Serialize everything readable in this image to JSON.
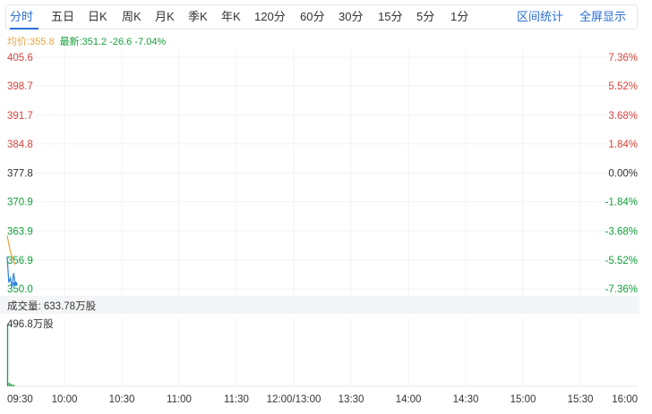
{
  "tabs": [
    {
      "label": "分时",
      "active": true
    },
    {
      "label": "五日"
    },
    {
      "label": "日K"
    },
    {
      "label": "周K"
    },
    {
      "label": "月K"
    },
    {
      "label": "季K"
    },
    {
      "label": "年K"
    },
    {
      "label": "120分"
    },
    {
      "label": "60分"
    },
    {
      "label": "30分"
    },
    {
      "label": "15分"
    },
    {
      "label": "5分"
    },
    {
      "label": "1分"
    }
  ],
  "links": {
    "range_stats": "区间统计",
    "fullscreen": "全屏显示"
  },
  "info": {
    "avg": "均价:355.8",
    "last": "最新:351.2 -26.6 -7.04%"
  },
  "volume": {
    "label": "成交量: 633.78万股"
  },
  "colors": {
    "up": "#d9453d",
    "down": "#14a03c",
    "flat": "#333333",
    "price_line": "#2b7fd9",
    "avg_line": "#e8a43c",
    "volume_bar": "#14a03c",
    "accent": "#2b6fd6"
  },
  "chart_data": [
    {
      "type": "line",
      "name": "price",
      "prev_close": 377.8,
      "ylim": [
        350.0,
        405.6
      ],
      "y_ticks": [
        {
          "price": "405.6",
          "pct": "7.36%",
          "dir": "up"
        },
        {
          "price": "398.7",
          "pct": "5.52%",
          "dir": "up"
        },
        {
          "price": "391.7",
          "pct": "3.68%",
          "dir": "up"
        },
        {
          "price": "384.8",
          "pct": "1.84%",
          "dir": "up"
        },
        {
          "price": "377.8",
          "pct": "0.00%",
          "dir": "flat"
        },
        {
          "price": "370.9",
          "pct": "-1.84%",
          "dir": "down"
        },
        {
          "price": "363.9",
          "pct": "-3.68%",
          "dir": "down"
        },
        {
          "price": "356.9",
          "pct": "-5.52%",
          "dir": "down"
        },
        {
          "price": "350.0",
          "pct": "-7.36%",
          "dir": "down"
        }
      ],
      "x_ticks": [
        "09:30",
        "10:00",
        "10:30",
        "11:00",
        "11:30",
        "12:00/13:00",
        "13:30",
        "14:00",
        "14:30",
        "15:00",
        "15:30",
        "16:00"
      ],
      "price_series": [
        {
          "t": 0,
          "v": 357.8
        },
        {
          "t": 1,
          "v": 351.5
        },
        {
          "t": 2,
          "v": 352.6
        },
        {
          "t": 3,
          "v": 350.3
        },
        {
          "t": 4,
          "v": 353.8
        },
        {
          "t": 5,
          "v": 351.2
        }
      ],
      "avg_series": [
        {
          "t": 0,
          "v": 362.8
        },
        {
          "t": 2,
          "v": 358.9
        },
        {
          "t": 5,
          "v": 355.8
        }
      ],
      "last_point": {
        "t": 5,
        "v": 351.2
      }
    },
    {
      "type": "bar",
      "name": "volume",
      "ylim": [
        0,
        496.8
      ],
      "y_tick_label": "496.8万股",
      "bars": [
        {
          "t": 0,
          "v": 496.8
        },
        {
          "t": 1,
          "v": 28
        },
        {
          "t": 2,
          "v": 20
        },
        {
          "t": 3,
          "v": 14
        },
        {
          "t": 4,
          "v": 10
        }
      ]
    }
  ]
}
